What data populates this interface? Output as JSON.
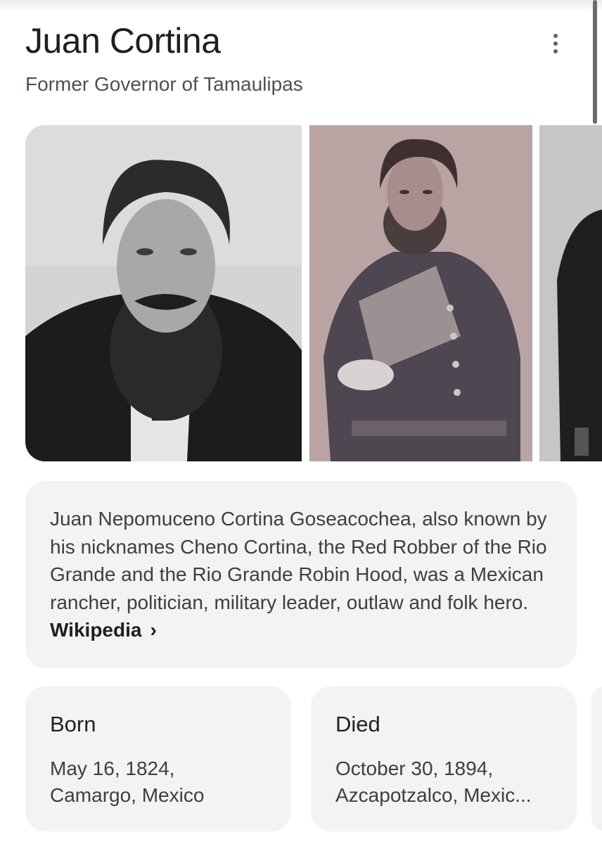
{
  "header": {
    "title": "Juan Cortina",
    "subtitle": "Former Governor of Tamaulipas"
  },
  "images": [
    {
      "alt": "Black and white portrait of bearded man in suit and bow tie"
    },
    {
      "alt": "Sepia photo of bearded man in military uniform"
    },
    {
      "alt": "Partial photo of man in dark suit"
    }
  ],
  "description": {
    "text": "Juan Nepomuceno Cortina Goseacochea, also known by his nicknames Cheno Cortina, the Red Robber of the Rio Grande and the Rio Grande Robin Hood, was a Mexican rancher, politician, military leader, outlaw and folk hero.",
    "source_link": "Wikipedia",
    "chevron": "›"
  },
  "facts": [
    {
      "label": "Born",
      "value": "May 16, 1824,\nCamargo, Mexico"
    },
    {
      "label": "Died",
      "value": "October 30, 1894,\nAzcapotzalco, Mexic..."
    }
  ]
}
